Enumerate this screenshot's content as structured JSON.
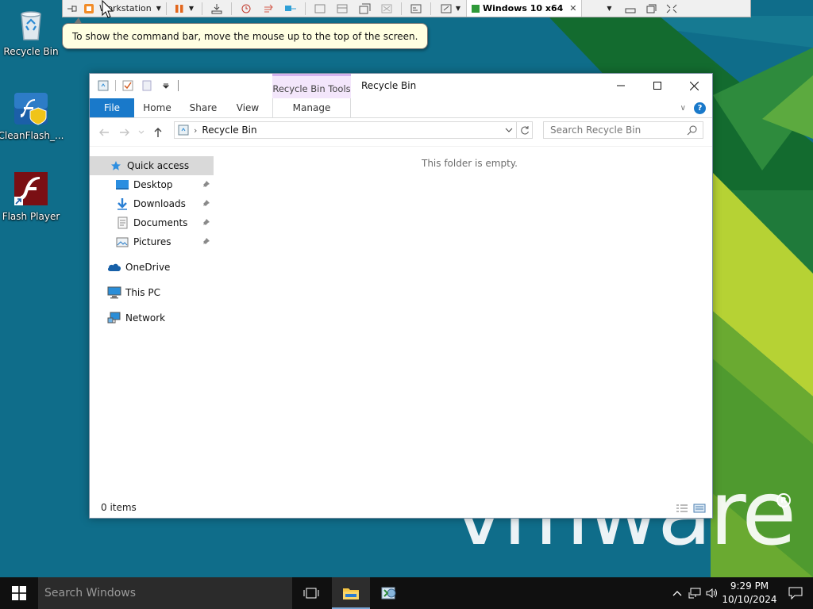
{
  "desktop": {
    "icons": [
      {
        "label": "Recycle Bin"
      },
      {
        "label": "CleanFlash_..."
      },
      {
        "label": "Flash Player"
      }
    ],
    "wallpaper_text": "vmware",
    "colors": {
      "teal": "#0f6d8a",
      "dark_green": "#136b2f",
      "lime": "#b6d234",
      "green": "#4ea33a"
    }
  },
  "vmware_bar": {
    "workstation_label": "Workstation",
    "vm_tab_label": "Windows 10 x64",
    "tooltip": "To show the command bar, move the mouse up to the top of the screen."
  },
  "explorer": {
    "context_tab_title": "Recycle Bin Tools",
    "window_title": "Recycle Bin",
    "tabs": {
      "file": "File",
      "home": "Home",
      "share": "Share",
      "view": "View",
      "manage": "Manage"
    },
    "address": {
      "path": "Recycle Bin"
    },
    "search": {
      "placeholder": "Search Recycle Bin"
    },
    "nav": {
      "quick_access": "Quick access",
      "desktop": "Desktop",
      "downloads": "Downloads",
      "documents": "Documents",
      "pictures": "Pictures",
      "onedrive": "OneDrive",
      "this_pc": "This PC",
      "network": "Network"
    },
    "empty_message": "This folder is empty.",
    "status": "0 items",
    "accent": "#1979ca"
  },
  "taskbar": {
    "search_placeholder": "Search Windows",
    "time": "9:29 PM",
    "date": "10/10/2024"
  }
}
